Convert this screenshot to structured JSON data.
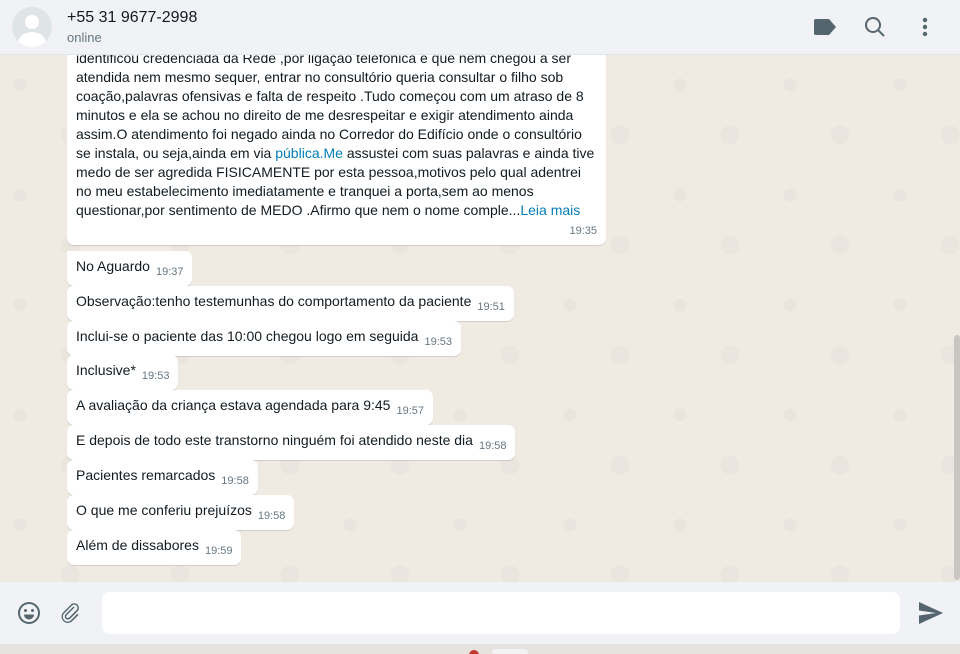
{
  "header": {
    "contact_name": "+55 31 9677-2998",
    "status": "online",
    "actions": [
      "label-icon",
      "search-icon",
      "menu-icon"
    ]
  },
  "long_message": {
    "lines": [
      "identificou credenciada da Rede ,por ligação telefônica e que nem chegou a ser",
      "atendida nem mesmo  sequer, entrar no consultório queria consultar o filho sob",
      "coação,palavras ofensivas e falta de respeito .Tudo começou com um atraso de 8",
      "minutos e ela se achou no direito de me desrespeitar e exigir atendimento ainda",
      "assim.O atendimento foi negado ainda no Corredor do Edifício onde o consultório",
      "se instala, ou seja,ainda em via "
    ],
    "link_text": "pública.Me",
    "after_link": " assustei com suas palavras e ainda tive",
    "lines_after": [
      "medo de ser agredida FISICAMENTE por esta pessoa,motivos pelo qual adentrei",
      "no meu estabelecimento imediatamente e tranquei a porta,sem ao menos",
      "questionar,por sentimento de MEDO .Afirmo que nem o nome comple..."
    ],
    "read_more": "Leia mais",
    "time": "19:35"
  },
  "messages": [
    {
      "text": "No Aguardo",
      "time": "19:37"
    },
    {
      "text": "Observação:tenho testemunhas do comportamento da paciente",
      "time": "19:51"
    },
    {
      "text": "Inclui-se o paciente das 10:00 chegou logo em seguida",
      "time": "19:53"
    },
    {
      "text": "Inclusive*",
      "time": "19:53"
    },
    {
      "text": "A avaliação da criança estava agendada para 9:45",
      "time": "19:57"
    },
    {
      "text": "E depois de todo este transtorno ninguém foi atendido neste dia",
      "time": "19:58"
    },
    {
      "text": "Pacientes remarcados",
      "time": "19:58"
    },
    {
      "text": "O que me conferiu prejuízos",
      "time": "19:58"
    },
    {
      "text": "Além de dissabores",
      "time": "19:59"
    }
  ],
  "composer": {
    "placeholder": "",
    "icons": [
      "emoji-icon",
      "attach-icon",
      "send-icon"
    ]
  }
}
